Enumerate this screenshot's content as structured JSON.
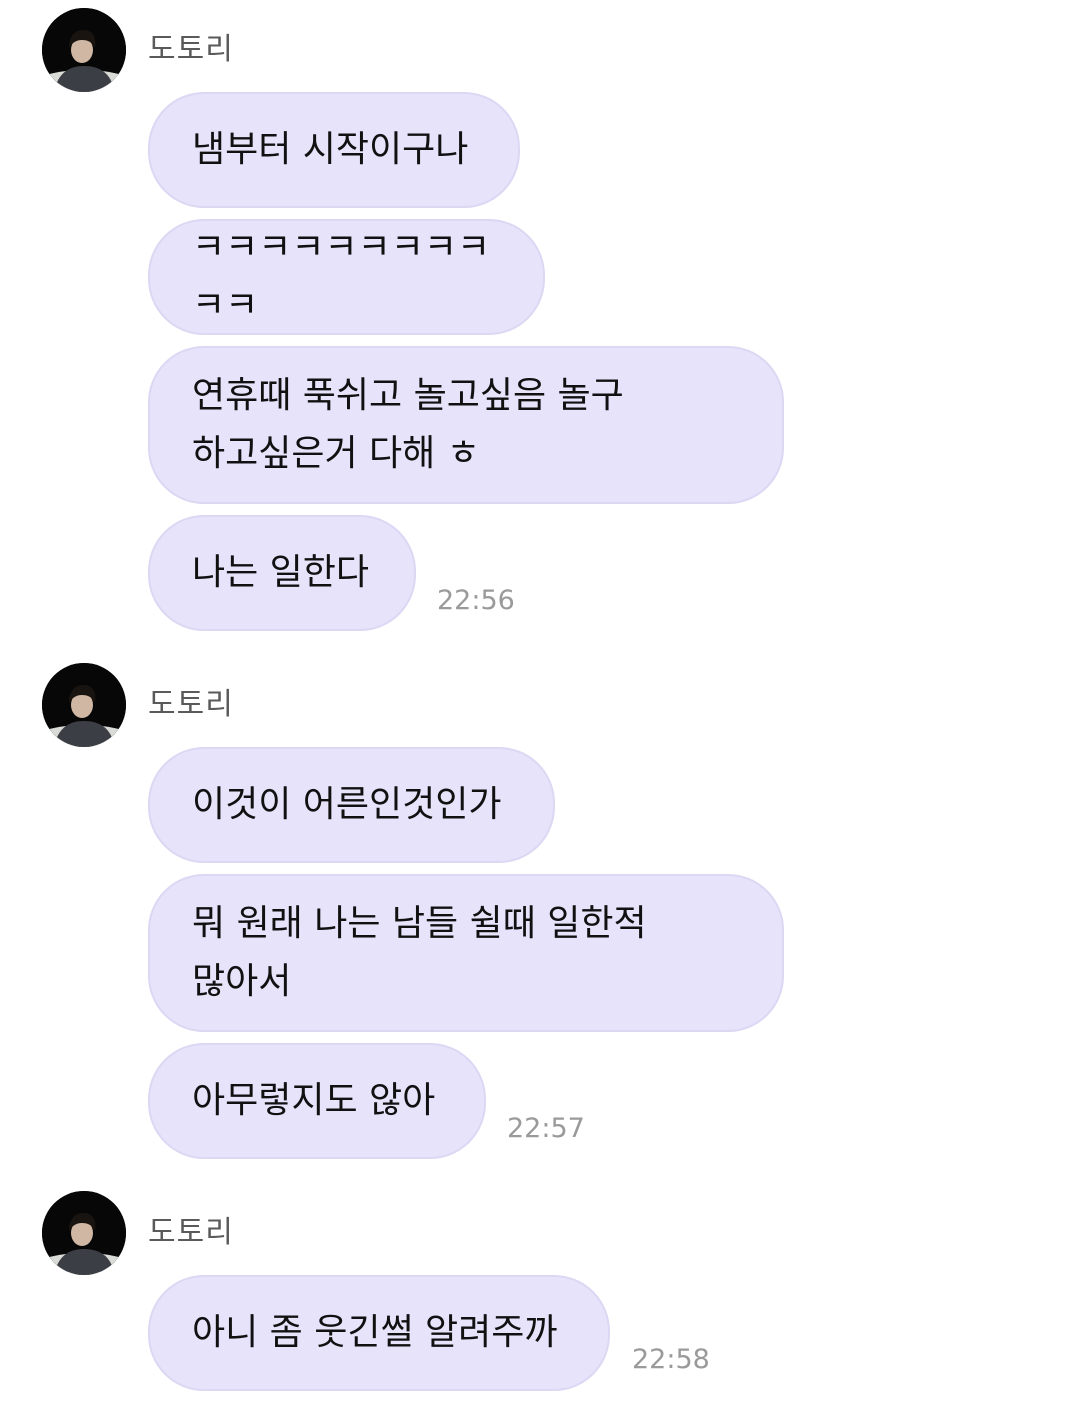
{
  "groups": [
    {
      "sender": "도토리",
      "avatar_icon": "profile-photo-avatar",
      "messages": [
        "냄부터 시작이구나",
        "ㅋㅋㅋㅋㅋㅋㅋㅋㅋㅋㅋ",
        "연휴때 푹쉬고 놀고싶음 놀구\n하고싶은거 다해 ㅎ",
        "나는 일한다"
      ],
      "time": "22:56"
    },
    {
      "sender": "도토리",
      "avatar_icon": "profile-photo-avatar",
      "messages": [
        "이것이 어른인것인가",
        "뭐 원래 나는 남들 쉴때 일한적\n많아서",
        "아무렇지도 않아"
      ],
      "time": "22:57"
    },
    {
      "sender": "도토리",
      "avatar_icon": "profile-photo-avatar",
      "messages": [
        "아니 좀 웃긴썰 알려주까"
      ],
      "time": "22:58"
    }
  ],
  "colors": {
    "bubble": "#e6e3fb",
    "bubble_border": "#dcd8f4",
    "sender_text": "#5a5a5a",
    "time_text": "#9a9a9a"
  }
}
